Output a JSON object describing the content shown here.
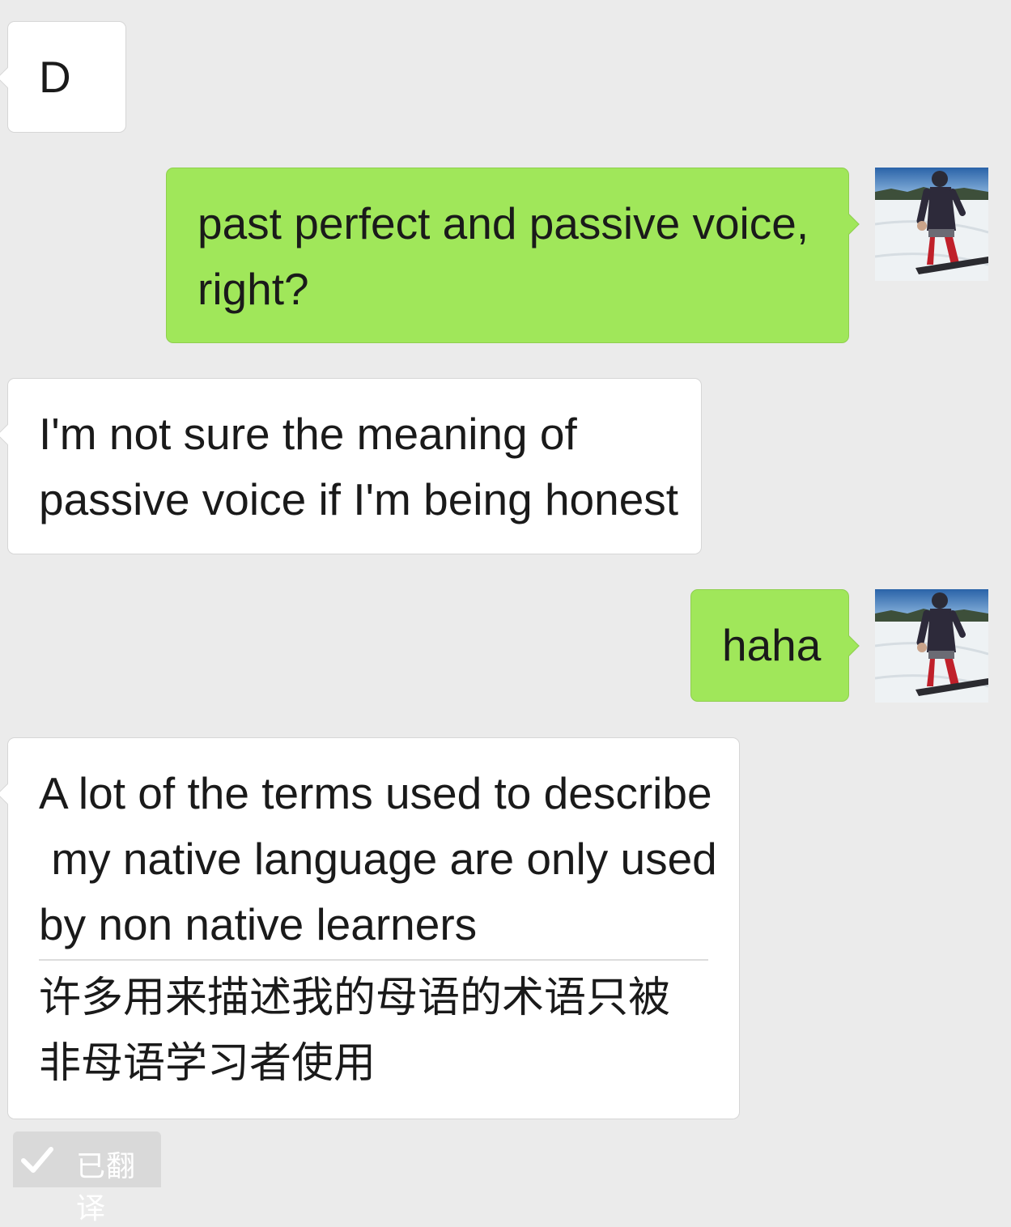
{
  "messages": [
    {
      "sender": "other",
      "text": "D"
    },
    {
      "sender": "self",
      "lines": [
        "past perfect and passive voice,",
        "right?"
      ]
    },
    {
      "sender": "other",
      "lines": [
        "I'm not sure the meaning of",
        "passive voice if I'm being honest"
      ]
    },
    {
      "sender": "self",
      "text": "haha"
    },
    {
      "sender": "other",
      "lines": [
        "A lot of the terms used to describe",
        " my native language are only used",
        "by non native learners"
      ],
      "translation_lines": [
        "许多用来描述我的母语的术语只被",
        "非母语学习者使用"
      ]
    }
  ],
  "translation_status": {
    "icon": "checkmark-icon",
    "label": "已翻译"
  },
  "colors": {
    "background": "#ebebeb",
    "incoming_bubble": "#ffffff",
    "outgoing_bubble": "#a0e75a",
    "text": "#1a1a1a",
    "badge": "#d9d9d9"
  },
  "avatar": {
    "icon": "user-avatar-snowboarder"
  }
}
